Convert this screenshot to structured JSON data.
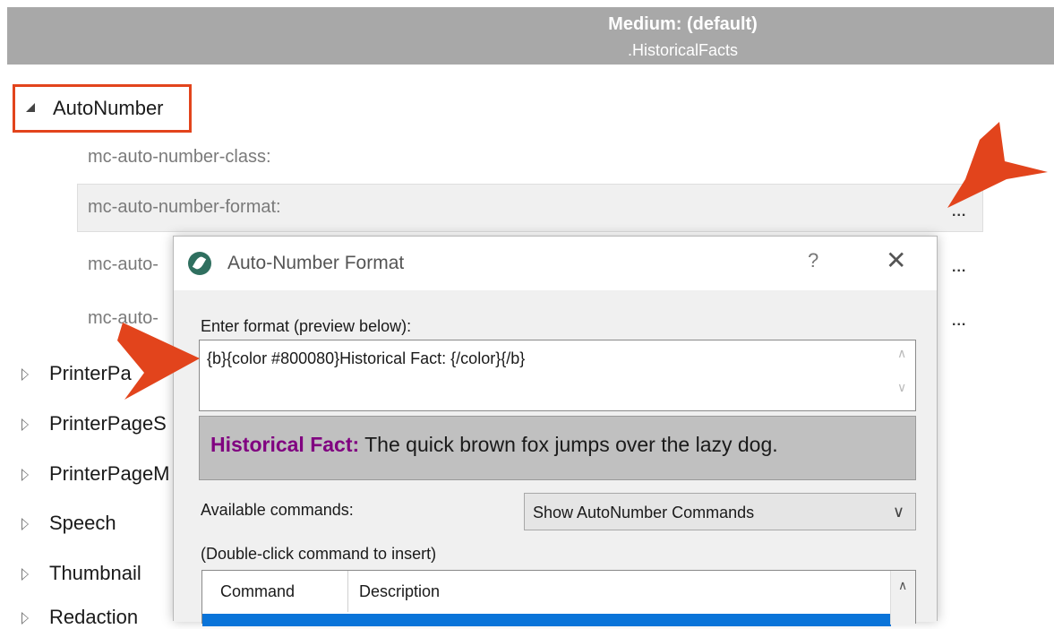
{
  "header": {
    "title": "Medium: (default)",
    "subtitle": ".HistoricalFacts"
  },
  "tree": {
    "root_label": "AutoNumber",
    "properties": [
      "mc-auto-number-class:",
      "mc-auto-number-format:",
      "mc-auto-",
      "mc-auto-"
    ],
    "ellipsis": "...",
    "items": [
      "PrinterPa",
      "PrinterPageS",
      "PrinterPageM",
      "Speech",
      "Thumbnail",
      "Redaction"
    ]
  },
  "dialog": {
    "title": "Auto-Number Format",
    "help_label": "?",
    "close_label": "✕",
    "enter_label": "Enter format (preview below):",
    "format_value": "{b}{color #800080}Historical Fact:  {/color}{/b}",
    "preview_bold": "Historical Fact:",
    "preview_text": "  The quick brown fox jumps over the lazy dog.",
    "available_label": "Available commands:",
    "available_selected": "Show AutoNumber Commands",
    "doubleclick_label": "(Double-click command to insert)",
    "grid_headers": [
      "Command",
      "Description"
    ]
  },
  "colors": {
    "accent_arrow": "#e2441c",
    "preview_text_color": "#800080",
    "selection_blue": "#0a74d9"
  }
}
